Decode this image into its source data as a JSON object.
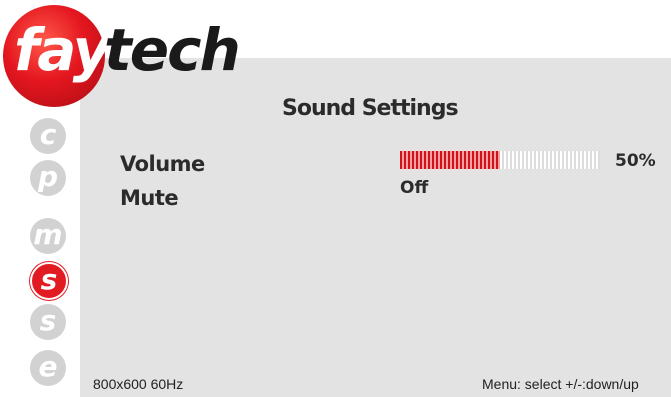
{
  "logo": {
    "part1": "fay",
    "part2": "tech"
  },
  "nav": [
    {
      "letter": "c",
      "icon": "c-icon",
      "active": false
    },
    {
      "letter": "p",
      "icon": "p-icon",
      "active": false
    },
    {
      "letter": "m",
      "icon": "m-icon",
      "active": false
    },
    {
      "letter": "s",
      "icon": "s-icon",
      "active": true
    },
    {
      "letter": "s",
      "icon": "s-icon",
      "active": false
    },
    {
      "letter": "e",
      "icon": "e-icon",
      "active": false
    }
  ],
  "title": "Sound Settings",
  "settings": {
    "volume": {
      "label": "Volume",
      "value": 0.5,
      "value_text": "50%"
    },
    "mute": {
      "label": "Mute",
      "value": "Off"
    }
  },
  "status": {
    "resolution": "800x600 60Hz",
    "hint": "Menu: select +/-:down/up"
  },
  "colors": {
    "accent": "#e21b22",
    "panel": "#e3e3e3",
    "icon_inactive": "#d2d2d2"
  }
}
